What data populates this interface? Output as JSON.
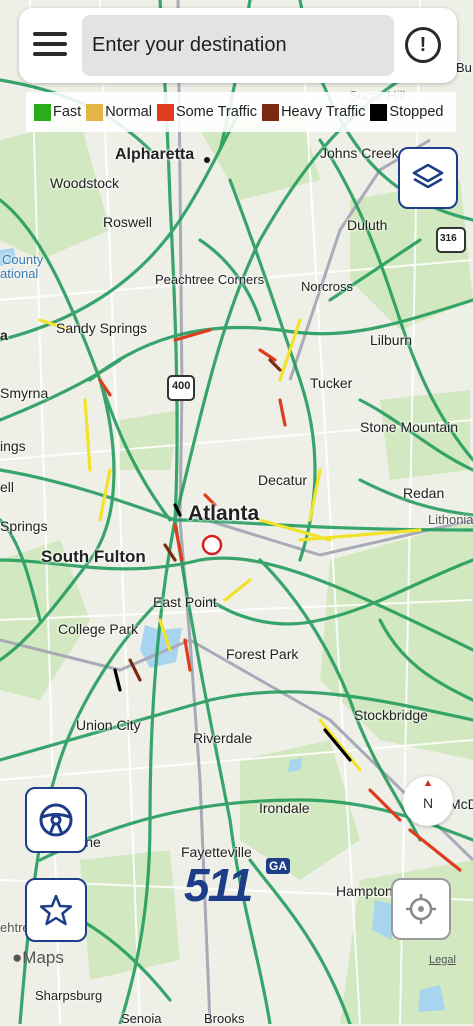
{
  "search": {
    "placeholder": "Enter your destination"
  },
  "legend": [
    {
      "label": "Fast",
      "color": "#2aad1a"
    },
    {
      "label": "Normal",
      "color": "#e3b542"
    },
    {
      "label": "Some Traffic",
      "color": "#e03b1c"
    },
    {
      "label": "Heavy Traffic",
      "color": "#7a2a12"
    },
    {
      "label": "Stopped",
      "color": "#000000"
    }
  ],
  "map": {
    "labels": {
      "alpharetta": "Alpharetta",
      "johns_creek": "Johns Creek",
      "woodstock": "Woodstock",
      "roswell": "Roswell",
      "duluth": "Duluth",
      "peachtree_corners": "Peachtree Corners",
      "norcross": "Norcross",
      "sugar_hill": "Sugar Hill",
      "sandy_springs": "Sandy Springs",
      "lilburn": "Lilburn",
      "smyrna": "Smyrna",
      "tucker": "Tucker",
      "stone_mountain": "Stone Mountain",
      "decatur": "Decatur",
      "redan": "Redan",
      "lithonia": "Lithonia",
      "atlanta": "Atlanta",
      "south_fulton": "South Fulton",
      "springs": "Springs",
      "east_point": "East Point",
      "college_park": "College Park",
      "forest_park": "Forest Park",
      "stockbridge": "Stockbridge",
      "union_city": "Union City",
      "riverdale": "Riverdale",
      "irondale": "Irondale",
      "mcdonough": "McD",
      "fayetteville": "Fayetteville",
      "tyrone": "Tyrone",
      "hampton": "Hampton",
      "sharpsburg": "Sharpsburg",
      "senoia": "Senoia",
      "brooks": "Brooks",
      "peachtree_city": "ehtree Cit",
      "county": "County",
      "national": "ational",
      "ings": "ings",
      "ell": "ell",
      "a_left": "a",
      "buford_edge": "Bu"
    },
    "shields": {
      "i400": "400",
      "i316": "316"
    }
  },
  "compass": {
    "label": "N"
  },
  "logo": {
    "text": "511",
    "badge": "GA"
  },
  "attribution": {
    "maps": "Maps",
    "legal": "Legal"
  }
}
